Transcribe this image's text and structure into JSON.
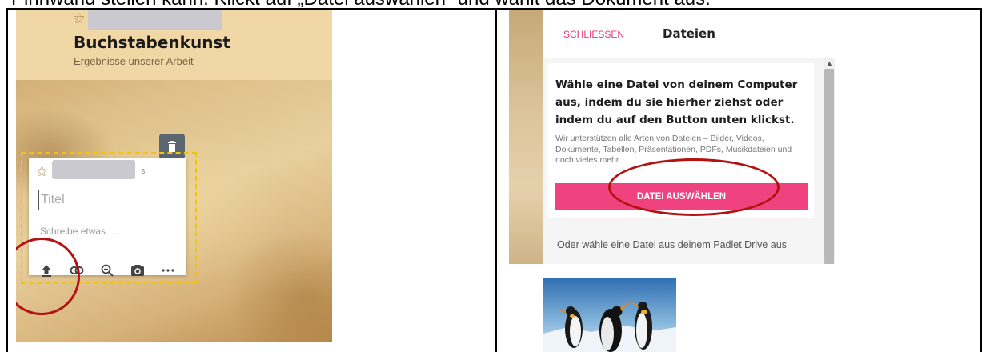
{
  "instruction": "Pinnwand stellen kann. Klickt auf „Datei auswählen“ und wählt das Dokument aus.",
  "padlet_board": {
    "title": "Buchstabenkunst",
    "subtitle": "Ergebnisse unserer Arbeit",
    "post": {
      "title_placeholder": "Titel",
      "body_placeholder": "Schreibe etwas …",
      "author_suffix": "s",
      "tools": [
        "upload-icon",
        "link-icon",
        "search-icon",
        "camera-icon",
        "more-icon"
      ]
    }
  },
  "file_dialog": {
    "close_label": "SCHLIESSEN",
    "title": "Dateien",
    "heading": "Wähle eine Datei von deinem Computer aus, indem du sie hierher ziehst oder indem du auf den Button unten klickst.",
    "note": "Wir unterstützen alle Arten von Dateien – Bilder, Videos, Dokumente, Tabellen, Präsentationen, PDFs, Musikdateien und noch vieles mehr.",
    "choose_button": "DATEI AUSWÄHLEN",
    "drive_text": "Oder wähle eine Datei aus deinem Padlet Drive aus"
  },
  "colors": {
    "accent_pink": "#f0427e",
    "highlight_red": "#b31212",
    "dashed_yellow": "#f1c40f"
  }
}
